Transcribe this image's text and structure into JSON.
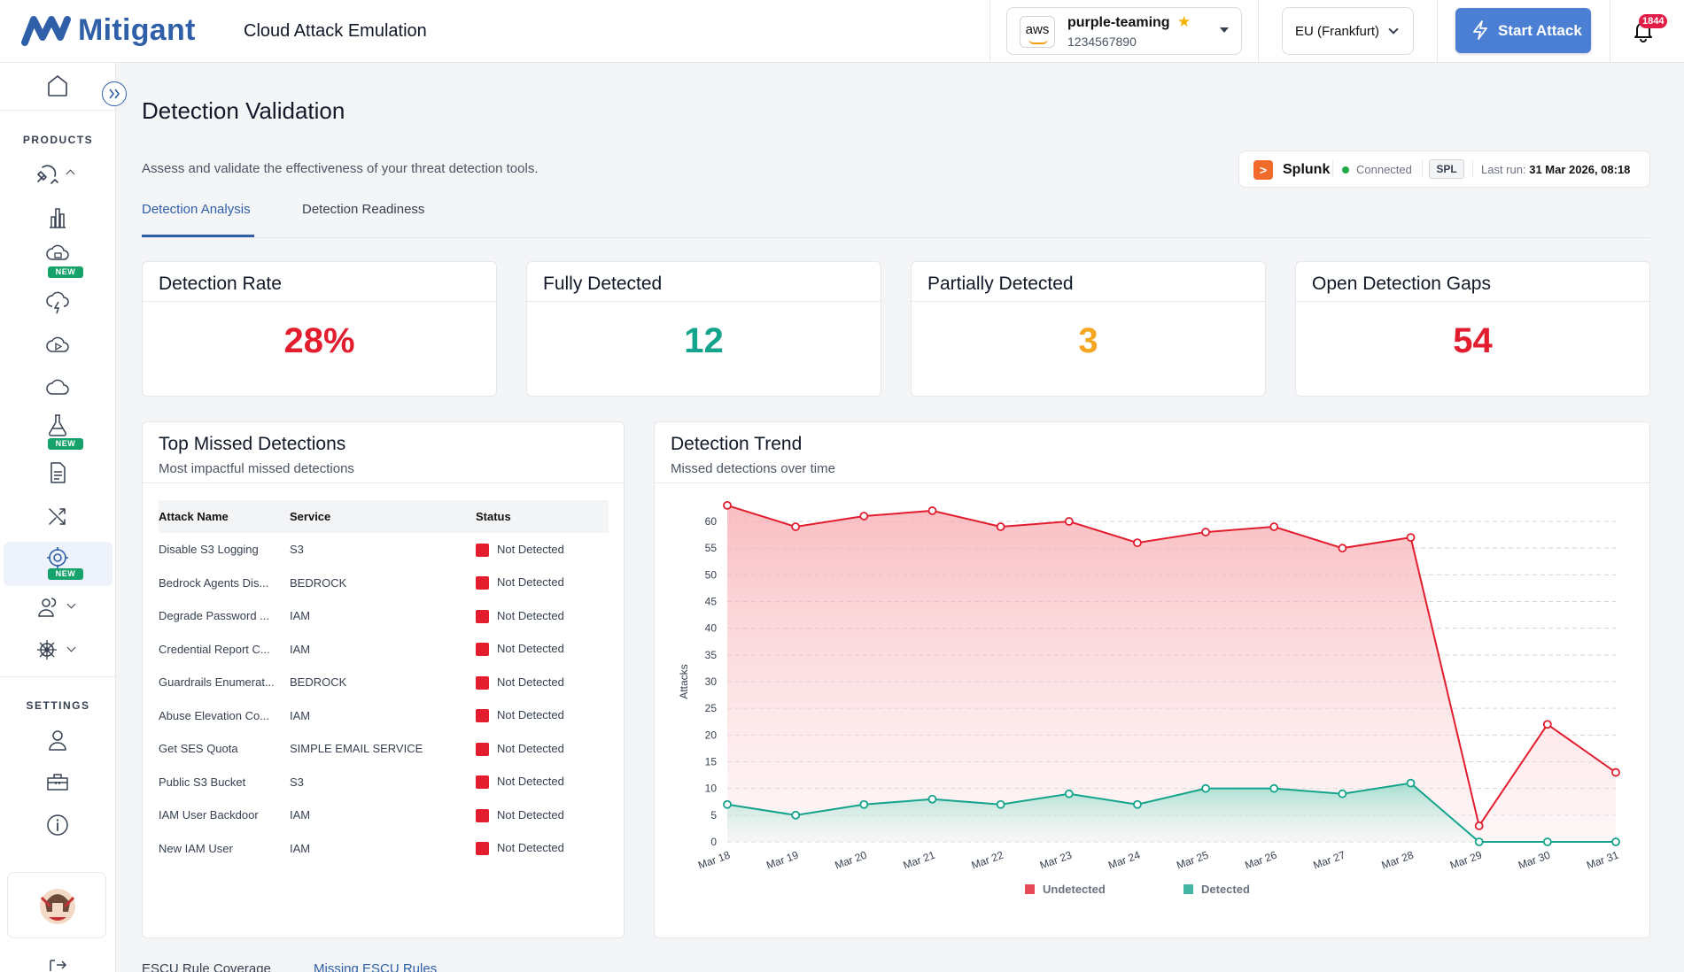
{
  "header": {
    "logo_text": "Mitigant",
    "app_title": "Cloud Attack Emulation",
    "account": {
      "provider": "aws",
      "name": "purple-teaming",
      "id": "1234567890"
    },
    "region": "EU (Frankfurt)",
    "start_button": "Start Attack",
    "notification_count": "1844"
  },
  "sidebar": {
    "products_label": "PRODUCTS",
    "settings_label": "SETTINGS",
    "new_badge": "NEW",
    "product_icons": [
      "home-icon",
      "attack-icon",
      "chart-icon",
      "cloud-lock-icon",
      "cloud-bolt-icon",
      "cloud-play-icon",
      "cloud-icon",
      "flask-icon",
      "document-icon",
      "shuffle-icon",
      "target-icon",
      "users-icon",
      "helm-icon"
    ],
    "settings_icons": [
      "user-icon",
      "toolbox-icon",
      "info-icon"
    ]
  },
  "page": {
    "title": "Detection Validation",
    "subtitle": "Assess and validate the effectiveness of your threat detection tools.",
    "integration": {
      "logo": ">",
      "name": "Splunk",
      "status": "Connected",
      "language": "SPL",
      "last_run_label": "Last run:",
      "last_run_value": "31 Mar 2026, 08:18"
    },
    "tabs": [
      "Detection Analysis",
      "Detection Readiness"
    ],
    "active_tab": "Detection Analysis"
  },
  "kpis": [
    {
      "label": "Detection Rate",
      "value": "28%",
      "color": "#e11d2e"
    },
    {
      "label": "Fully Detected",
      "value": "12",
      "color": "#14a38b"
    },
    {
      "label": "Partially Detected",
      "value": "3",
      "color": "#f5a623"
    },
    {
      "label": "Open Detection Gaps",
      "value": "54",
      "color": "#e11d2e"
    }
  ],
  "missed": {
    "title": "Top Missed Detections",
    "subtitle": "Most impactful missed detections",
    "columns": [
      "Attack Name",
      "Service",
      "Status"
    ],
    "rows": [
      [
        "Disable S3 Logging",
        "S3",
        "Not Detected"
      ],
      [
        "Bedrock Agents Dis...",
        "BEDROCK",
        "Not Detected"
      ],
      [
        "Degrade Password ...",
        "IAM",
        "Not Detected"
      ],
      [
        "Credential Report C...",
        "IAM",
        "Not Detected"
      ],
      [
        "Guardrails Enumerat...",
        "BEDROCK",
        "Not Detected"
      ],
      [
        "Abuse Elevation Co...",
        "IAM",
        "Not Detected"
      ],
      [
        "Get SES Quota",
        "SIMPLE EMAIL SERVICE",
        "Not Detected"
      ],
      [
        "Public S3 Bucket",
        "S3",
        "Not Detected"
      ],
      [
        "IAM User Backdoor",
        "IAM",
        "Not Detected"
      ],
      [
        "New IAM User",
        "IAM",
        "Not Detected"
      ]
    ]
  },
  "trend": {
    "title": "Detection Trend",
    "subtitle": "Missed detections over time"
  },
  "chart_data": {
    "type": "area",
    "title": "Detection Trend",
    "subtitle": "Missed detections over time",
    "xlabel": "",
    "ylabel": "Attacks",
    "ylim": [
      0,
      60
    ],
    "yticks": [
      0,
      5,
      10,
      15,
      20,
      25,
      30,
      35,
      40,
      45,
      50,
      55,
      60
    ],
    "grid": true,
    "legend": "bottom",
    "categories": [
      "Mar 18",
      "Mar 19",
      "Mar 20",
      "Mar 21",
      "Mar 22",
      "Mar 23",
      "Mar 24",
      "Mar 25",
      "Mar 26",
      "Mar 27",
      "Mar 28",
      "Mar 29",
      "Mar 30",
      "Mar 31"
    ],
    "series": [
      {
        "name": "Undetected",
        "color": "#e11d2e",
        "values": [
          63,
          59,
          61,
          62,
          59,
          60,
          56,
          58,
          59,
          55,
          57,
          3,
          22,
          13
        ]
      },
      {
        "name": "Detected",
        "color": "#14a38b",
        "values": [
          7,
          5,
          7,
          8,
          7,
          9,
          7,
          10,
          10,
          9,
          11,
          0,
          0,
          0
        ]
      }
    ]
  },
  "bottom_tabs": [
    "ESCU Rule Coverage",
    "Missing ESCU Rules"
  ]
}
